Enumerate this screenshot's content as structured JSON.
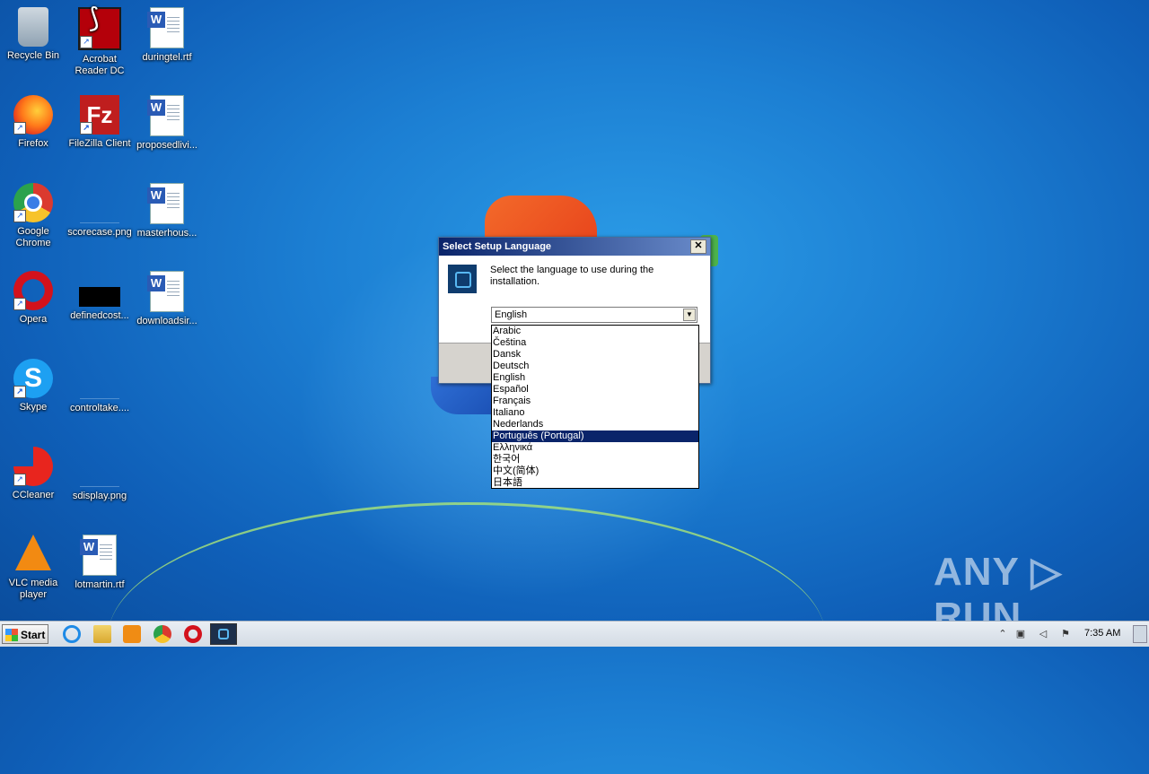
{
  "desktop": {
    "icons": [
      {
        "id": "recycle-bin",
        "label": "Recycle Bin",
        "shortcut": false
      },
      {
        "id": "acrobat",
        "label": "Acrobat Reader DC",
        "shortcut": true
      },
      {
        "id": "duringtel",
        "label": "duringtel.rtf",
        "shortcut": false
      },
      {
        "id": "firefox",
        "label": "Firefox",
        "shortcut": true
      },
      {
        "id": "filezilla",
        "label": "FileZilla Client",
        "shortcut": true
      },
      {
        "id": "proposedlivi",
        "label": "proposedlivi...",
        "shortcut": false
      },
      {
        "id": "chrome",
        "label": "Google Chrome",
        "shortcut": true
      },
      {
        "id": "scorecase",
        "label": "scorecase.png",
        "shortcut": false
      },
      {
        "id": "masterhous",
        "label": "masterhous...",
        "shortcut": false
      },
      {
        "id": "opera",
        "label": "Opera",
        "shortcut": true
      },
      {
        "id": "definedcost",
        "label": "definedcost...",
        "shortcut": false
      },
      {
        "id": "downloadsir",
        "label": "downloadsir...",
        "shortcut": false
      },
      {
        "id": "skype",
        "label": "Skype",
        "shortcut": true
      },
      {
        "id": "controltake",
        "label": "controltake....",
        "shortcut": false
      },
      {
        "id": "ccleaner",
        "label": "CCleaner",
        "shortcut": true
      },
      {
        "id": "sdisplay",
        "label": "sdisplay.png",
        "shortcut": false
      },
      {
        "id": "vlc",
        "label": "VLC media player",
        "shortcut": true
      },
      {
        "id": "lotmartin",
        "label": "lotmartin.rtf",
        "shortcut": false
      }
    ]
  },
  "dialog": {
    "title": "Select Setup Language",
    "close_glyph": "✕",
    "message": "Select the language to use during the installation.",
    "combo_value": "English",
    "combo_arrow": "▼",
    "options": [
      "Arabic",
      "Čeština",
      "Dansk",
      "Deutsch",
      "English",
      "Español",
      "Français",
      "Italiano",
      "Nederlands",
      "Português (Portugal)",
      "Ελληνικά",
      "한국어",
      "中文(简体)",
      "日本語"
    ],
    "highlighted_option": "Português (Portugal)"
  },
  "watermark": "ANY ▷ RUN",
  "taskbar": {
    "start_label": "Start",
    "clock": "7:35 AM",
    "tray_icons": [
      "chevron-up-icon",
      "network-icon",
      "volume-icon",
      "flag-icon"
    ]
  },
  "colors": {
    "title_bar": "#0a246a",
    "selection": "#0a246a",
    "desktop": "#1c7fd3"
  }
}
